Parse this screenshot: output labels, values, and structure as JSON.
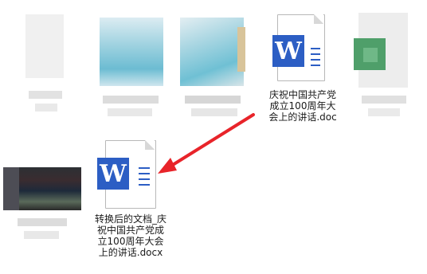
{
  "files": [
    {
      "label_lines": [
        "庆祝中国共产党",
        "成立100周年大",
        "会上的讲话.doc"
      ]
    },
    {
      "label_lines": [
        "转换后的文档_庆",
        "祝中国共产党成",
        "立100周年大会",
        "上的讲话.docx"
      ]
    }
  ],
  "icons": {
    "word_letter": "W",
    "word_color": "#2c5ec4",
    "arrow_color": "#e8242a"
  }
}
